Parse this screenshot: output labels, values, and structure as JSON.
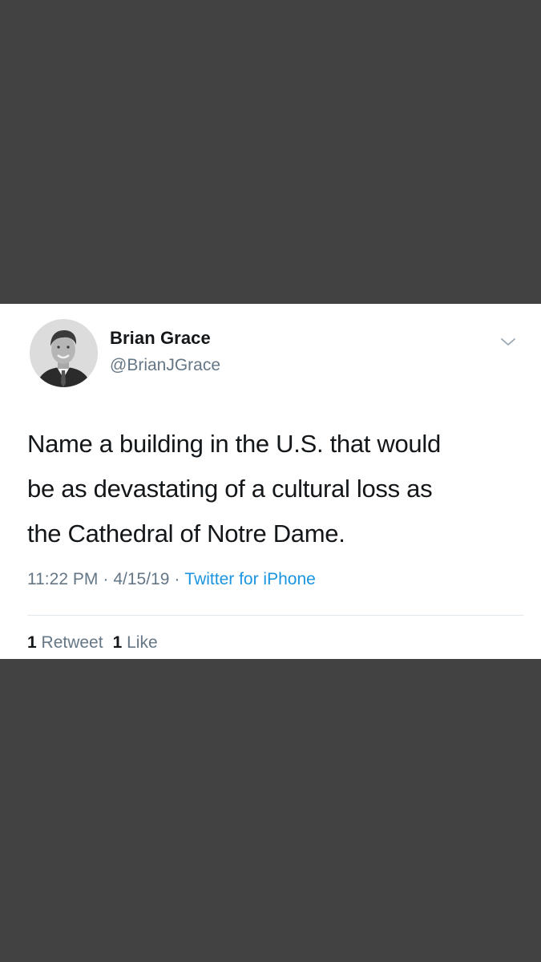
{
  "tweet": {
    "author": {
      "display_name": "Brian Grace",
      "handle": "@BrianJGrace",
      "avatar_icon": "profile-photo"
    },
    "menu_icon": "chevron-down-icon",
    "text_lines": [
      "Name a building in the U.S. that would",
      "be as devastating of a cultural loss as",
      "the Cathedral of Notre Dame."
    ],
    "meta": {
      "time": "11:22 PM",
      "separator": "·",
      "date": "4/15/19",
      "source": "Twitter for iPhone"
    },
    "stats": {
      "retweets_count": "1",
      "retweets_label": "Retweet",
      "likes_count": "1",
      "likes_label": "Like"
    }
  },
  "colors": {
    "background": "#424242",
    "card": "#ffffff",
    "text": "#14171a",
    "secondary": "#657786",
    "link": "#1b95e0",
    "divider": "#e1e8ed"
  }
}
